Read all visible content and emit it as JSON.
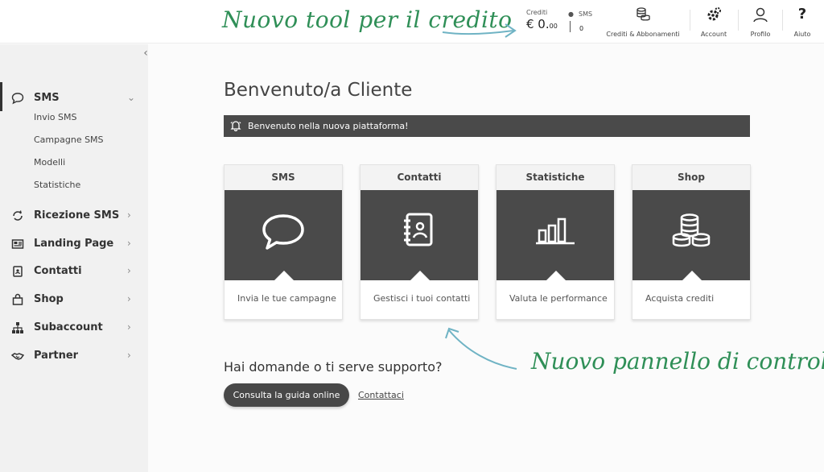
{
  "annotations": {
    "top": "Nuovo tool per il credito",
    "bottom": "Nuovo pannello di controllo"
  },
  "header": {
    "credits_label": "Crediti",
    "credits_value": "€ 0.",
    "credits_cents": "00",
    "sms_label": "SMS",
    "sms_value": "0",
    "subscriptions_label": "Crediti & Abbonamenti",
    "account_label": "Account",
    "profile_label": "Profilo",
    "help_label": "Aiuto"
  },
  "sidebar": {
    "collapse_icon": "chevron-left-icon",
    "items": [
      {
        "label": "SMS",
        "icon": "chat-bubble-icon",
        "expanded": true
      },
      {
        "label": "Ricezione SMS",
        "icon": "refresh-chat-icon"
      },
      {
        "label": "Landing Page",
        "icon": "newspaper-icon"
      },
      {
        "label": "Contatti",
        "icon": "address-book-icon"
      },
      {
        "label": "Shop",
        "icon": "shopping-bag-icon"
      },
      {
        "label": "Subaccount",
        "icon": "sitemap-icon"
      },
      {
        "label": "Partner",
        "icon": "handshake-icon"
      }
    ],
    "sms_subitems": [
      "Invio SMS",
      "Campagne SMS",
      "Modelli",
      "Statistiche"
    ]
  },
  "main": {
    "title": "Benvenuto/a Cliente",
    "banner": "Benvenuto nella nuova piattaforma!",
    "cards": [
      {
        "title": "SMS",
        "caption": "Invia le tue campagne",
        "icon": "chat-bubble-icon"
      },
      {
        "title": "Contatti",
        "caption": "Gestisci i tuoi contatti",
        "icon": "address-book-icon"
      },
      {
        "title": "Statistiche",
        "caption": "Valuta le performance",
        "icon": "bar-chart-icon"
      },
      {
        "title": "Shop",
        "caption": "Acquista crediti",
        "icon": "coins-icon"
      }
    ],
    "help_question": "Hai domande o ti serve supporto?",
    "guide_button": "Consulta la guida online",
    "contact_link": "Contattaci"
  },
  "colors": {
    "annotation_green": "#2f8f57",
    "arrow_teal": "#6fb3c4",
    "dark_panel": "#4a4a4a",
    "sidebar_bg": "#f1f1f1"
  }
}
